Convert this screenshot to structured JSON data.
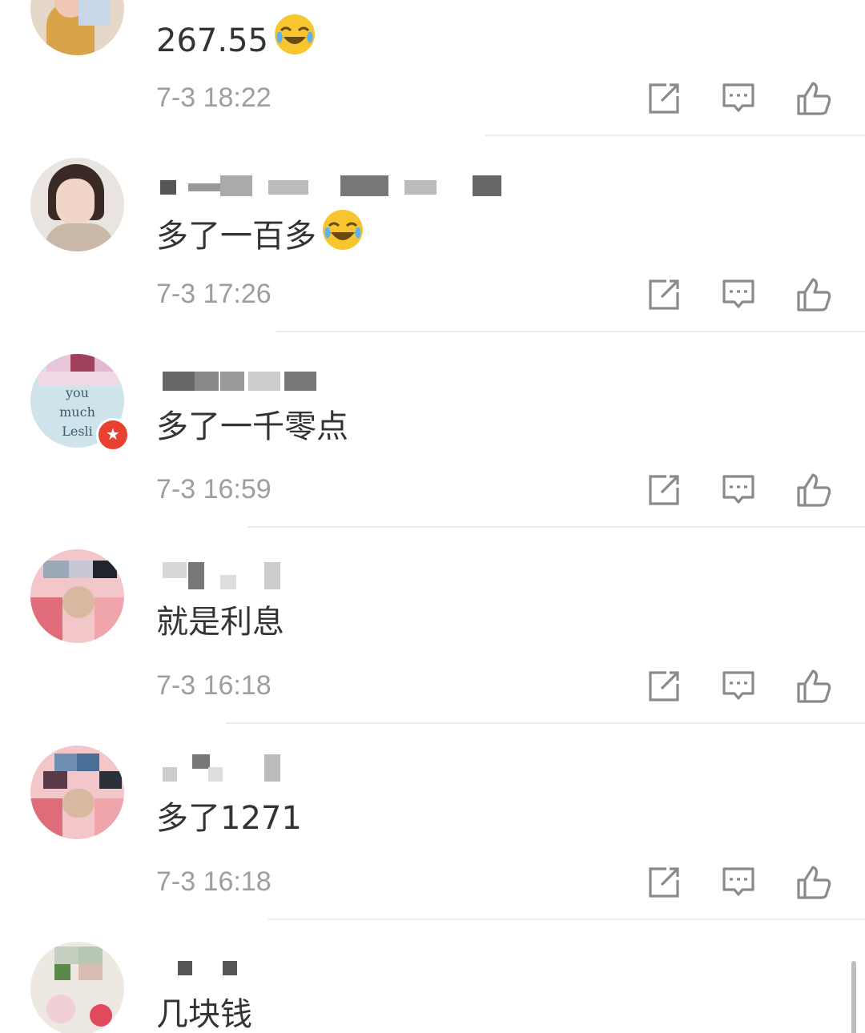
{
  "comments": [
    {
      "text": "267.55",
      "time": "7-3 18:22"
    },
    {
      "text": "多了一百多",
      "time": "7-3 17:26"
    },
    {
      "text": "多了一千零点",
      "time": "7-3 16:59",
      "avatar_words": [
        "you",
        "much",
        "Lesli"
      ]
    },
    {
      "text": "就是利息",
      "time": "7-3 16:18"
    },
    {
      "text": "多了1271",
      "time": "7-3 16:18"
    },
    {
      "text": "几块钱"
    }
  ],
  "icons": {
    "share": "share-icon",
    "reply": "comment-icon",
    "like": "thumbs-up-icon",
    "emoji": "laughing-tears-emoji"
  },
  "colors": {
    "text": "#333333",
    "meta": "#9e9e9e",
    "icon": "#8a8a8a",
    "badge": "#e8412f",
    "divider": "#ececec"
  }
}
